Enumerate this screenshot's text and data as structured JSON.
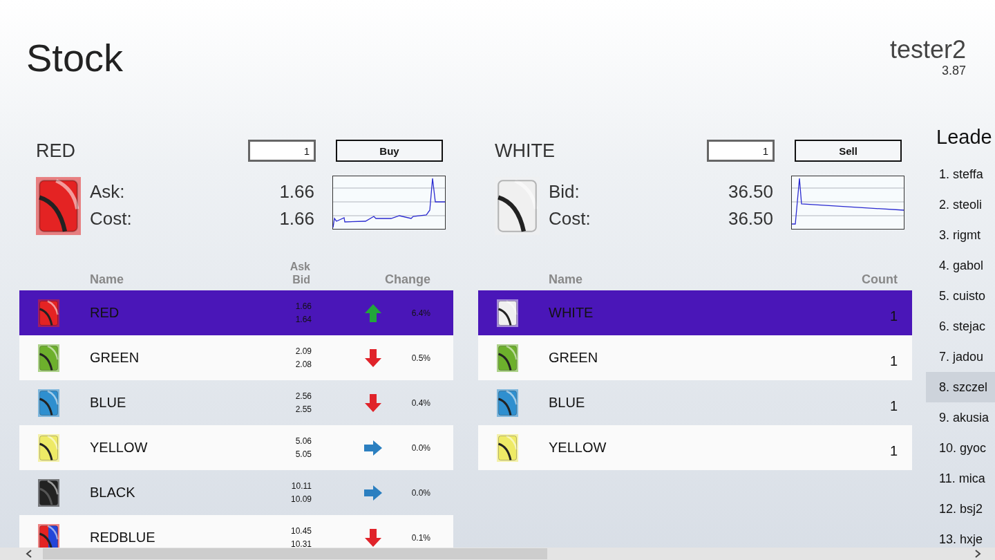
{
  "header": {
    "title": "Stock",
    "user": "tester2",
    "balance": "3.87"
  },
  "buy_panel": {
    "name": "RED",
    "color": "#e42323",
    "quantity": "1",
    "action": "Buy",
    "info": [
      {
        "label": "Ask:",
        "value": "1.66"
      },
      {
        "label": "Cost:",
        "value": "1.66"
      }
    ],
    "columns": [
      {
        "lines": [
          "Name"
        ]
      },
      {
        "lines": [
          "Ask",
          "Bid"
        ]
      },
      {
        "lines": [
          "Change"
        ]
      }
    ],
    "rows": [
      {
        "name": "RED",
        "color": "#e42323",
        "ask": "1.66",
        "bid": "1.64",
        "kind": "up",
        "change": "6.4%",
        "selected": true
      },
      {
        "name": "GREEN",
        "color": "#6db02c",
        "ask": "2.09",
        "bid": "2.08",
        "kind": "down",
        "change": "0.5%",
        "selected": false
      },
      {
        "name": "BLUE",
        "color": "#2f8fcf",
        "ask": "2.56",
        "bid": "2.55",
        "kind": "down",
        "change": "0.4%",
        "selected": false
      },
      {
        "name": "YELLOW",
        "color": "#eeea66",
        "ask": "5.06",
        "bid": "5.05",
        "kind": "flat",
        "change": "0.0%",
        "selected": false
      },
      {
        "name": "BLACK",
        "color": "#222222",
        "ask": "10.11",
        "bid": "10.09",
        "kind": "flat",
        "change": "0.0%",
        "selected": false
      },
      {
        "name": "REDBLUE",
        "color": "#e42323",
        "accent": {
          "color": "#2346d8"
        },
        "ask": "10.45",
        "bid": "10.31",
        "kind": "down",
        "change": "0.1%",
        "selected": false
      }
    ]
  },
  "sell_panel": {
    "name": "WHITE",
    "color": "#f0f0f0",
    "quantity": "1",
    "action": "Sell",
    "info": [
      {
        "label": "Bid:",
        "value": "36.50"
      },
      {
        "label": "Cost:",
        "value": "36.50"
      }
    ],
    "columns": [
      {
        "lines": [
          "Name"
        ]
      },
      {
        "lines": [
          "Count"
        ]
      }
    ],
    "rows": [
      {
        "name": "WHITE",
        "color": "#f0f0f0",
        "count": "1",
        "selected": true
      },
      {
        "name": "GREEN",
        "color": "#6db02c",
        "count": "1",
        "selected": false
      },
      {
        "name": "BLUE",
        "color": "#2f8fcf",
        "count": "1",
        "selected": false
      },
      {
        "name": "YELLOW",
        "color": "#eeea66",
        "count": "1",
        "selected": false
      }
    ]
  },
  "leaderboard": {
    "title": "Leade",
    "items": [
      {
        "label": "1. steffa",
        "selected": false
      },
      {
        "label": "2. steoli",
        "selected": false
      },
      {
        "label": "3. rigmt",
        "selected": false
      },
      {
        "label": "4. gabol",
        "selected": false
      },
      {
        "label": "5. cuisto",
        "selected": false
      },
      {
        "label": "6. stejac",
        "selected": false
      },
      {
        "label": "7. jadou",
        "selected": false
      },
      {
        "label": "8. szczel",
        "selected": true
      },
      {
        "label": "9. akusia",
        "selected": false
      },
      {
        "label": "10. gyoc",
        "selected": false
      },
      {
        "label": "11. mica",
        "selected": false
      },
      {
        "label": "12. bsj2",
        "selected": false
      },
      {
        "label": "13. hxje",
        "selected": false
      }
    ]
  }
}
